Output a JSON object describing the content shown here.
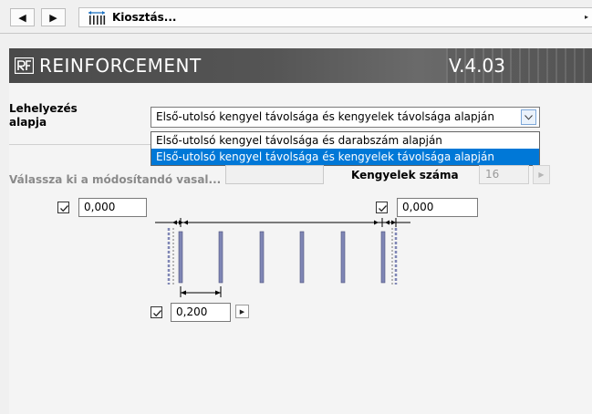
{
  "toolbar": {
    "back_symbol": "◀",
    "forward_symbol": "▶",
    "tab_title": "Kiosztás...",
    "tab_icon": "rebar-distribution-icon",
    "tab_menu_symbol": "▸"
  },
  "banner": {
    "title": "REINFORCEMENT",
    "version": "V.4.03",
    "logo": "rf-logo-icon"
  },
  "placement": {
    "label": "Lehelyezés alapja",
    "selected_value": "Első-utolsó kengyel távolsága és kengyelek távolsága alapján",
    "options": [
      "Első-utolsó kengyel távolsága és darabszám alapján",
      "Első-utolsó kengyel távolsága és kengyelek távolsága alapján"
    ],
    "highlighted_index": 1
  },
  "rebar_select": {
    "label": "Válassza ki a módosítandó vasal...",
    "value": ""
  },
  "stirrup_count": {
    "label": "Kengyelek száma",
    "value": "16",
    "arrow_symbol": "▶"
  },
  "first_offset": {
    "checked": true,
    "value": "0,000"
  },
  "last_offset": {
    "checked": true,
    "value": "0,000"
  },
  "spacing": {
    "checked": true,
    "value": "0,200",
    "arrow_symbol": "▶"
  },
  "colors": {
    "banner_bg": "#555555",
    "selection": "#0078d7",
    "stirrup": "#7f86b5"
  }
}
